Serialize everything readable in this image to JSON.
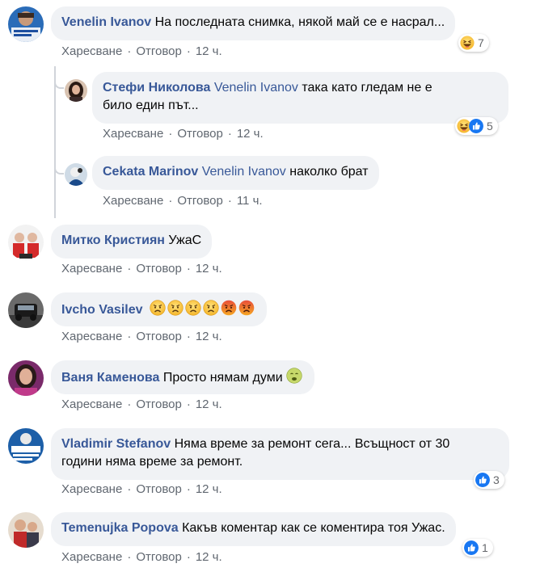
{
  "labels": {
    "like": "Харесване",
    "reply": "Отговор",
    "sep": "·"
  },
  "comments": [
    {
      "author": "Venelin Ivanov",
      "text": " На последната снимка, някой май се е насрал...",
      "time": "12 ч.",
      "reaction_count": "7"
    },
    {
      "author": "Стефи Николова",
      "mention": "Venelin Ivanov",
      "text_line1": " така като гледам не е",
      "text_line2": "било един път...",
      "time": "12 ч.",
      "reaction_count": "5"
    },
    {
      "author": "Cekata Marinov",
      "mention": "Venelin Ivanov",
      "text": " наколко брат",
      "time": "11 ч."
    },
    {
      "author": "Митко Кристиян",
      "text": " УжаС",
      "time": "12 ч."
    },
    {
      "author": "Ivcho Vasilev",
      "text": "",
      "time": "12 ч."
    },
    {
      "author": "Ваня Каменова",
      "text": " Просто нямам думи",
      "time": "12 ч."
    },
    {
      "author": "Vladimir Stefanov",
      "text_line1": " Няма време за ремонт сега... Всъщност от 30",
      "text_line2": "години няма време за ремонт.",
      "time": "12 ч.",
      "reaction_count": "3"
    },
    {
      "author": "Temenujka Popova",
      "text": " Какъв коментар как се коментира тоя Ужас.",
      "time": "12 ч.",
      "reaction_count": "1"
    }
  ],
  "colors": {
    "author": "#385898",
    "bubble": "#f0f2f5",
    "meta": "#606770",
    "like_blue": "#1877f2",
    "haha_yellow": "#f7b928",
    "angry_red": "#e9573e"
  }
}
